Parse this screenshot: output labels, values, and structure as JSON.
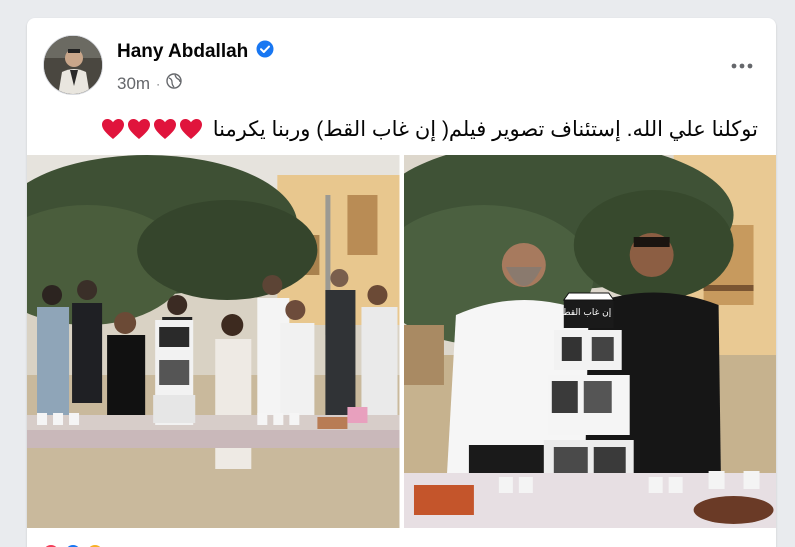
{
  "post": {
    "author": "Hany Abdallah",
    "time": "30m",
    "text": "توكلنا علي الله. إستئناف تصوير فيلم( إن غاب القط) وربنا يكرمنا",
    "hearts_count": 4
  },
  "photos": [
    {
      "id": "group-cake-photo"
    },
    {
      "id": "two-men-cake-photo",
      "clapper_text": "إن غاب القط"
    }
  ],
  "colors": {
    "verified": "#1877f2",
    "heart": "#e0143c",
    "secondary_text": "#65676b"
  },
  "icons": [
    "verified-badge-icon",
    "globe-icon",
    "more-options-icon",
    "heart-icon"
  ]
}
